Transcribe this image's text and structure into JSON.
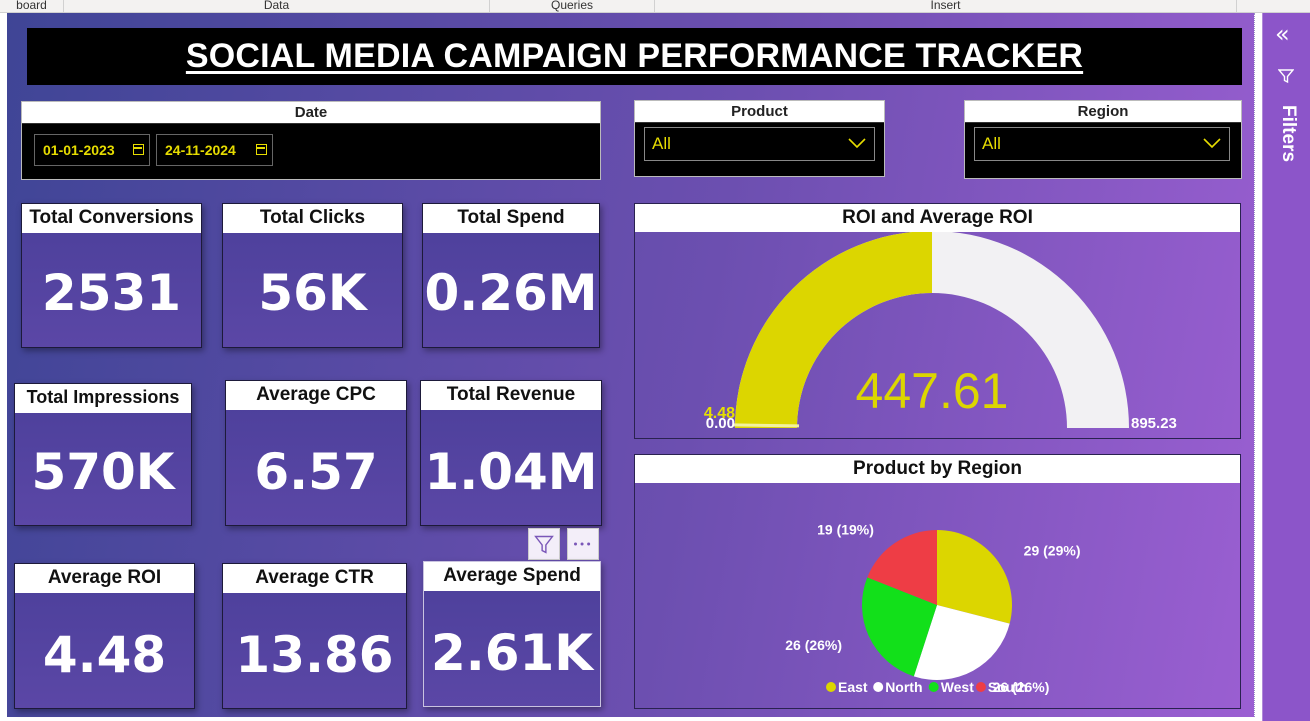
{
  "ribbon": {
    "tabs": [
      "board",
      "Data",
      "Queries",
      "Insert"
    ]
  },
  "filters_pane": {
    "label": "Filters",
    "collapse_glyph": "«",
    "icons": [
      "collapse-icon",
      "funnel-icon"
    ]
  },
  "title": "SOCIAL MEDIA CAMPAIGN PERFORMANCE TRACKER",
  "slicers": {
    "date": {
      "label": "Date",
      "start": "01-01-2023",
      "end": "24-11-2024"
    },
    "product": {
      "label": "Product",
      "value": "All"
    },
    "region": {
      "label": "Region",
      "value": "All"
    }
  },
  "kpis": {
    "total_conversions": {
      "label": "Total Conversions",
      "value": "2531"
    },
    "total_clicks": {
      "label": "Total Clicks",
      "value": "56K"
    },
    "total_spend": {
      "label": "Total Spend",
      "value": "0.26M"
    },
    "total_impressions": {
      "label": "Total Impressions",
      "value": "570K"
    },
    "average_cpc": {
      "label": "Average CPC",
      "value": "6.57"
    },
    "total_revenue": {
      "label": "Total Revenue",
      "value": "1.04M"
    },
    "average_roi": {
      "label": "Average ROI",
      "value": "4.48"
    },
    "average_ctr": {
      "label": "Average CTR",
      "value": "13.86"
    },
    "average_spend": {
      "label": "Average Spend",
      "value": "2.61K"
    }
  },
  "gauge": {
    "title": "ROI and Average ROI",
    "value": 447.61,
    "value_label": "447.61",
    "min_label": "0.00",
    "max_label": "895.23",
    "target_label": "4.48",
    "min": 0,
    "max": 895.23,
    "target": 4.48,
    "colors": {
      "fill": "#dcd600",
      "track": "#f2f1f3",
      "target": "#f2f1a0"
    }
  },
  "chart_data": {
    "type": "pie",
    "title": "Product by Region",
    "slices": [
      {
        "name": "East",
        "value": 29,
        "label": "29 (29%)",
        "color": "#dcd600"
      },
      {
        "name": "North",
        "value": 26,
        "label": "26 (26%)",
        "color": "#ffffff"
      },
      {
        "name": "West",
        "value": 26,
        "label": "26 (26%)",
        "color": "#12e01a"
      },
      {
        "name": "South",
        "value": 19,
        "label": "19 (19%)",
        "color": "#ee3d45"
      }
    ],
    "legend": [
      "East",
      "North",
      "West",
      "South"
    ],
    "legend_position": "bottom"
  }
}
